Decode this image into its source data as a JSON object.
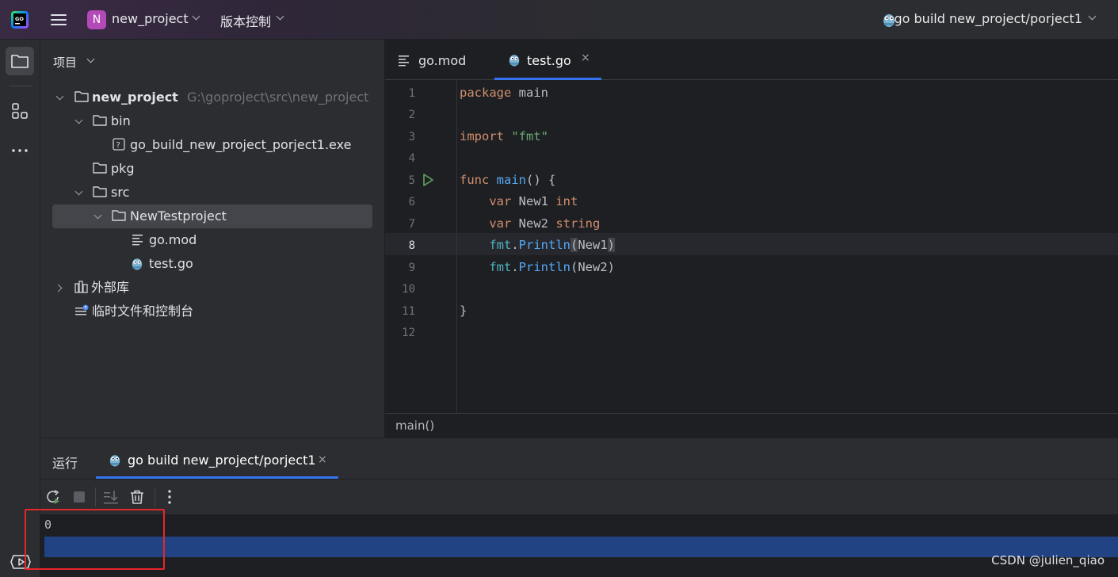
{
  "titlebar": {
    "project_badge": "N",
    "project_name": "new_project",
    "vcs_label": "版本控制",
    "run_config": "go build new_project/porject1",
    "app_logo": "goland-logo",
    "accent_badge_color": "#b24bb8"
  },
  "toolstrip": {
    "items": [
      "folder-icon",
      "structure-icon",
      "more-icon"
    ],
    "bottom": "services-icon"
  },
  "project_panel": {
    "title": "项目",
    "tree": [
      {
        "label": "new_project",
        "hint": "G:\\goproject\\src\\new_project",
        "icon": "folder-icon",
        "expanded": true
      },
      {
        "label": "bin",
        "icon": "folder-icon",
        "expanded": true
      },
      {
        "label": "go_build_new_project_porject1.exe",
        "icon": "unknown-file-icon"
      },
      {
        "label": "pkg",
        "icon": "folder-icon"
      },
      {
        "label": "src",
        "icon": "folder-icon",
        "expanded": true
      },
      {
        "label": "NewTestproject",
        "icon": "folder-icon",
        "expanded": true,
        "selected": true
      },
      {
        "label": "go.mod",
        "icon": "gomod-file-icon"
      },
      {
        "label": "test.go",
        "icon": "go-file-icon"
      },
      {
        "label": "外部库",
        "icon": "library-icon",
        "expanded": false
      },
      {
        "label": "临时文件和控制台",
        "icon": "scratch-icon"
      }
    ]
  },
  "editor": {
    "tabs": [
      {
        "label": "go.mod",
        "icon": "gomod-file-icon",
        "active": false
      },
      {
        "label": "test.go",
        "icon": "go-file-icon",
        "active": true,
        "close": "×"
      }
    ],
    "line_numbers": [
      "1",
      "2",
      "3",
      "4",
      "5",
      "6",
      "7",
      "8",
      "9",
      "10",
      "11",
      "12"
    ],
    "current_line": "8",
    "code": {
      "l1_kw": "package",
      "l1_name": "main",
      "l3_kw": "import",
      "l3_str": "\"fmt\"",
      "l5_kw": "func",
      "l5_fn": "main",
      "l5_rest": "() {",
      "l6_kw": "var",
      "l6_name": "New1",
      "l6_type": "int",
      "l7_kw": "var",
      "l7_name": "New2",
      "l7_type": "string",
      "l8_pkg": "fmt",
      "l8_call": "Println",
      "l8_open": "(",
      "l8_arg": "New1",
      "l8_close": ")",
      "l9_pkg": "fmt",
      "l9_call": "Println",
      "l9_arg": "(New2)",
      "l11": "}"
    },
    "breadcrumb": "main()"
  },
  "run_panel": {
    "title": "运行",
    "tab_label": "go build new_project/porject1",
    "tab_close": "×",
    "toolbar": [
      "rerun-icon",
      "stop-icon",
      "scroll-to-end-icon",
      "clear-icon",
      "more-vertical-icon"
    ],
    "console_output": "0"
  },
  "watermark": "CSDN @julien_qiao",
  "colors": {
    "accent": "#3574f0",
    "selection": "#214283",
    "annotation_box": "#e8262a"
  }
}
